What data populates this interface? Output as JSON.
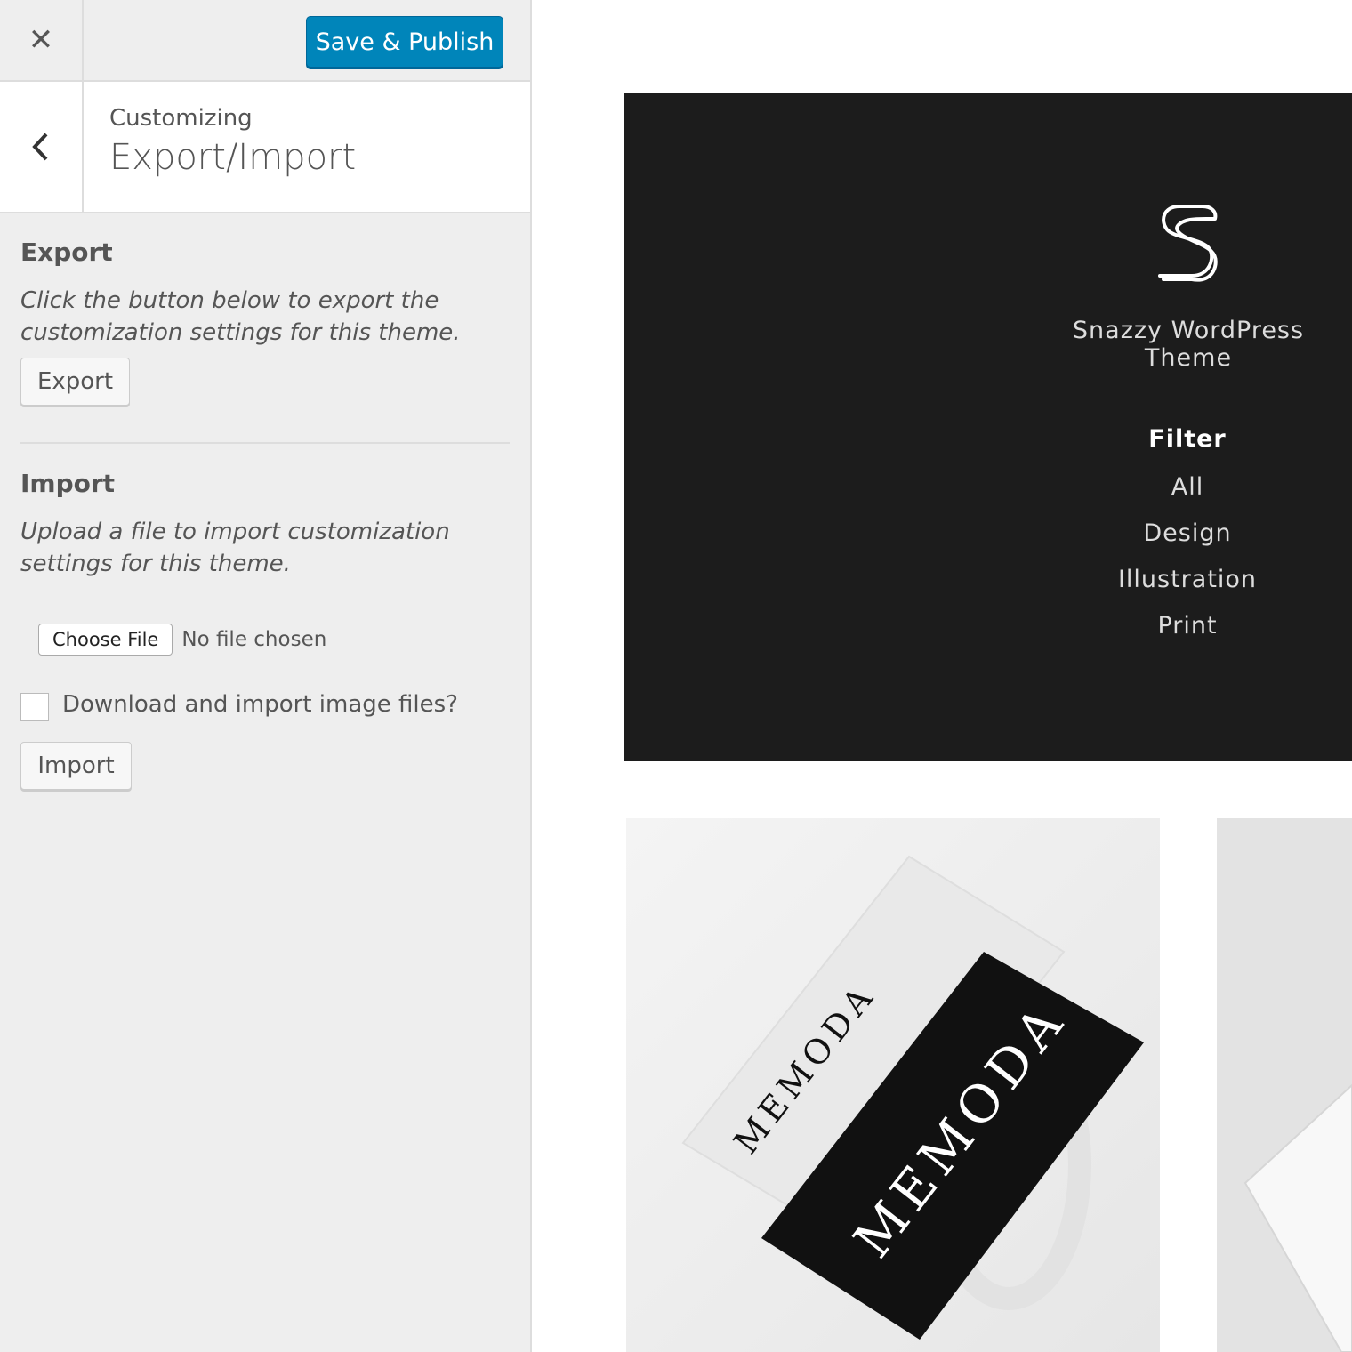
{
  "toolbar": {
    "close_icon": "close-icon",
    "save_label": "Save & Publish"
  },
  "header": {
    "back_icon": "chevron-left-icon",
    "customizing": "Customizing",
    "section_title": "Export/Import"
  },
  "export": {
    "heading": "Export",
    "description": "Click the button below to export the customization settings for this theme.",
    "button_label": "Export"
  },
  "import": {
    "heading": "Import",
    "description": "Upload a file to import customization settings for this theme.",
    "choose_file_label": "Choose File",
    "file_status": "No file chosen",
    "checkbox_label": "Download and import image files?",
    "checkbox_checked": false,
    "button_label": "Import"
  },
  "preview": {
    "logo_icon": "snazzy-s-logo",
    "site_name": "Snazzy WordPress Theme",
    "filter_title": "Filter",
    "filters": [
      "All",
      "Design",
      "Illustration",
      "Print"
    ],
    "card_brand_text": "MEMODA"
  },
  "colors": {
    "primary_button": "#0085ba",
    "sidebar_bg": "#eeeeee",
    "hero_bg": "#1c1c1c"
  }
}
